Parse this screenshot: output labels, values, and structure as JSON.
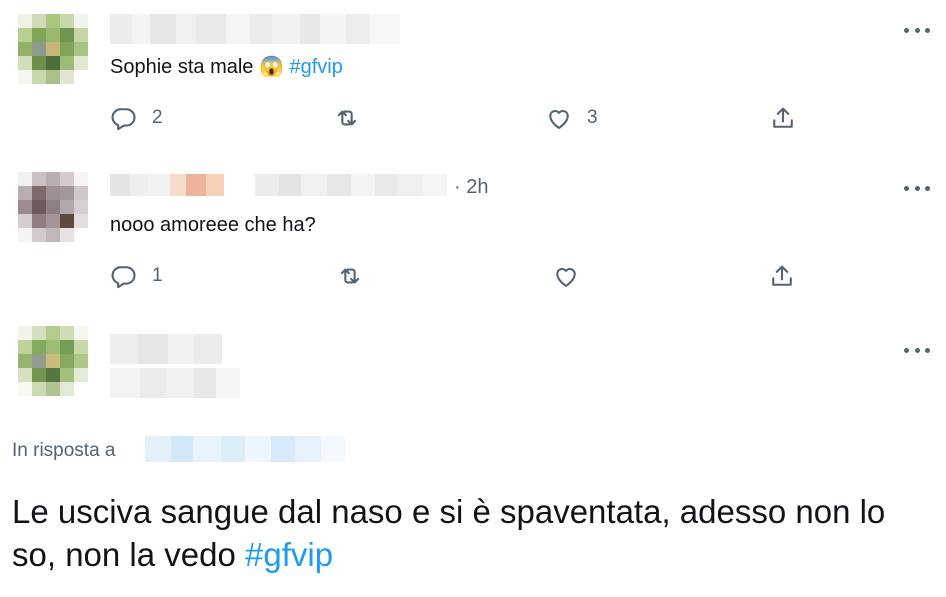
{
  "colors": {
    "text": "#0f1419",
    "muted": "#536471",
    "link": "#1d9bf0"
  },
  "tweets": [
    {
      "text": "Sophie sta male",
      "emoji": "😱",
      "hashtag": "#gfvip",
      "time": "",
      "actions": {
        "reply_count": "2",
        "retweet_count": "",
        "like_count": "3"
      }
    },
    {
      "text": "nooo amoreee che ha?",
      "emoji": "",
      "hashtag": "",
      "time": "· 2h",
      "actions": {
        "reply_count": "1",
        "retweet_count": "",
        "like_count": ""
      }
    }
  ],
  "main_tweet": {
    "reply_to_prefix": "In risposta a",
    "text": "Le usciva sangue dal naso e si è spaventata, adesso non lo so, non la vedo",
    "hashtag": "#gfvip"
  },
  "icons": {
    "reply": "reply-icon",
    "retweet": "retweet-icon",
    "like": "heart-icon",
    "share": "share-icon",
    "more": "more-icon"
  }
}
